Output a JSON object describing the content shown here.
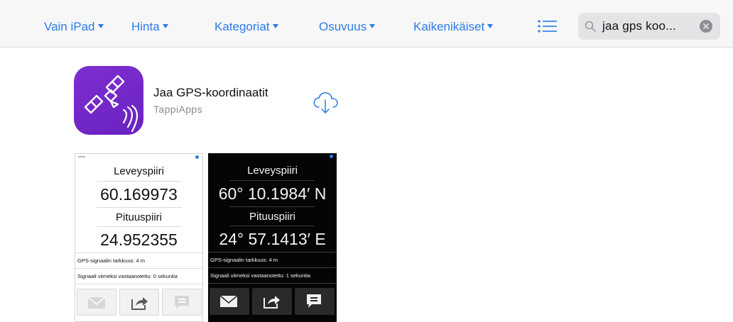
{
  "colors": {
    "accent": "#2a7be4",
    "app_icon_purple": "#7526c9",
    "bar_bg": "#f7f7f8"
  },
  "filters": [
    {
      "label": "Vain iPad"
    },
    {
      "label": "Hinta"
    },
    {
      "label": "Kategoriat"
    },
    {
      "label": "Osuvuus"
    },
    {
      "label": "Kaikenikäiset"
    }
  ],
  "toolbar": {
    "list_icon": "list-icon"
  },
  "search": {
    "query": "jaa gps koo...",
    "icon": "magnifier-icon",
    "clear_icon": "clear-icon"
  },
  "app": {
    "title": "Jaa GPS-koordinaatit",
    "developer": "TappiApps",
    "icon": "satellite-icon",
    "get_icon": "cloud-download-icon"
  },
  "screenshots": {
    "light": {
      "lat_label": "Leveyspiiri",
      "lat_value": "60.169973",
      "lon_label": "Pituuspiiri",
      "lon_value": "24.952355",
      "accuracy": "GPS-signaalin tarkkuus: 4 m",
      "last_signal": "Signaali viimeksi vastaanotettu: 0 sekuntia"
    },
    "dark": {
      "lat_label": "Leveyspiiri",
      "lat_value": "60° 10.1984′ N",
      "lon_label": "Pituuspiiri",
      "lon_value": "24° 57.1413′ E",
      "accuracy": "GPS-signaalin tarkkuus: 4 m",
      "last_signal": "Signaali viimeksi vastaanotettu: 1 sekuntia"
    },
    "button_icons": [
      "mail-icon",
      "share-icon",
      "message-icon"
    ]
  }
}
